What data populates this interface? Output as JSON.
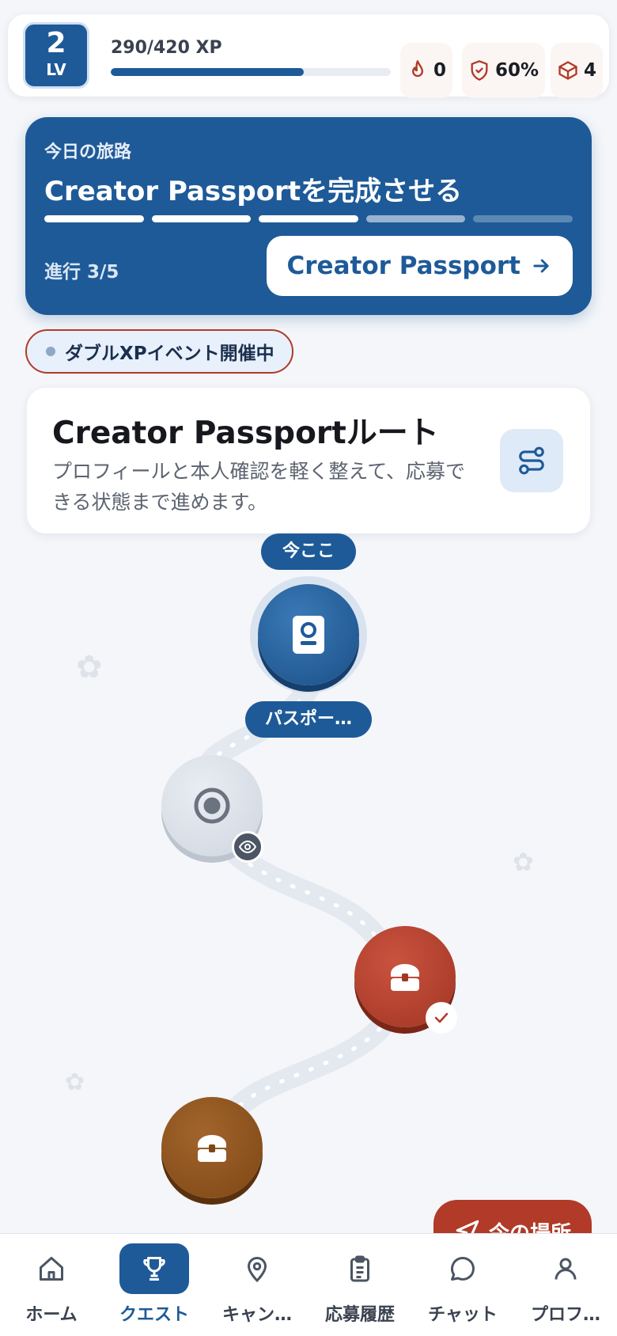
{
  "header": {
    "level": "2",
    "level_label": "LV",
    "xp_text": "290/420 XP",
    "xp_progress": 0.69,
    "streak": "0",
    "shield_pct": "60%",
    "boxes": "4"
  },
  "journey": {
    "subtitle": "今日の旅路",
    "title": "Creator Passportを完成させる",
    "segments": [
      "done",
      "done",
      "done",
      "half",
      "empty"
    ],
    "progress_label": "進行 3/5",
    "cta_label": "Creator Passport"
  },
  "event": {
    "label": "ダブルXPイベント開催中"
  },
  "route": {
    "title": "Creator Passportルート",
    "description": "プロフィールと本人確認を軽く整えて、応募できる状態まで進めます。"
  },
  "map": {
    "current_marker": "今ここ",
    "current_node_label": "パスポー…",
    "locate_button": "今の場所"
  },
  "nav": {
    "items": [
      {
        "label": "ホーム",
        "icon": "home-icon"
      },
      {
        "label": "クエスト",
        "icon": "trophy-icon",
        "active": true
      },
      {
        "label": "キャン…",
        "icon": "map-pin-icon"
      },
      {
        "label": "応募履歴",
        "icon": "clipboard-icon"
      },
      {
        "label": "チャット",
        "icon": "chat-icon"
      },
      {
        "label": "プロフ…",
        "icon": "user-icon"
      }
    ]
  },
  "colors": {
    "primary": "#1e5a98",
    "accent_red": "#b13a28",
    "chest_brown": "#8a5120"
  }
}
